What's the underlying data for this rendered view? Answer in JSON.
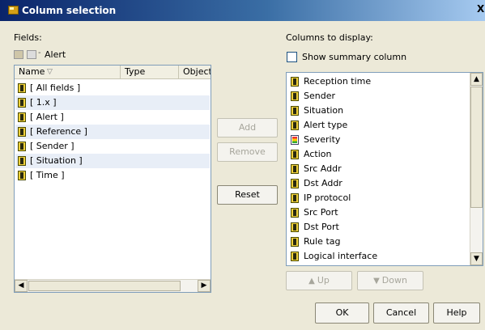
{
  "window": {
    "title": "Column selection",
    "close_label": "X"
  },
  "fields": {
    "label": "Fields:",
    "breadcrumb": "Alert",
    "columns": {
      "name": "Name",
      "type": "Type",
      "object": "Object"
    },
    "items": [
      "[ All fields ]",
      "[ 1.x ]",
      "[ Alert ]",
      "[ Reference ]",
      "[ Sender ]",
      "[ Situation ]",
      "[ Time ]"
    ]
  },
  "actions": {
    "add": "Add",
    "remove": "Remove",
    "reset": "Reset"
  },
  "columns_to_display": {
    "label": "Columns to display:",
    "summary_checkbox": "Show summary column",
    "items": [
      "Reception time",
      "Sender",
      "Situation",
      "Alert type",
      "Severity",
      "Action",
      "Src Addr",
      "Dst Addr",
      "IP protocol",
      "Src Port",
      "Dst Port",
      "Rule tag",
      "Logical interface"
    ]
  },
  "move": {
    "up": "Up",
    "down": "Down"
  },
  "dialog": {
    "ok": "OK",
    "cancel": "Cancel",
    "help": "Help"
  }
}
